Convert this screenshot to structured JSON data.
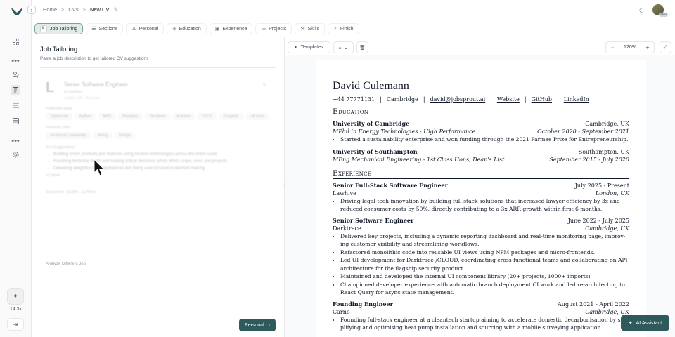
{
  "breadcrumb": {
    "home": "Home",
    "cvs": "CVs",
    "current": "New CV"
  },
  "avatar_badge": "PRO",
  "rail": {
    "count": "14.3k"
  },
  "steps": [
    {
      "label": "Job Tailoring",
      "icon": "L"
    },
    {
      "label": "Sections",
      "icon": "sliders-icon"
    },
    {
      "label": "Personal",
      "icon": "person-icon"
    },
    {
      "label": "Education",
      "icon": "graduation-cap-icon"
    },
    {
      "label": "Experience",
      "icon": "briefcase-icon"
    },
    {
      "label": "Projects",
      "icon": "folder-icon"
    },
    {
      "label": "Skills",
      "icon": "wrench-icon"
    },
    {
      "label": "Finish",
      "icon": "check-circle-icon"
    }
  ],
  "panel": {
    "title": "Job Tailoring",
    "subtitle": "Paste a job description to get tailored CV suggestions",
    "next_label": "Personal"
  },
  "job": {
    "letter": "L",
    "title": "Senior Software Engineer",
    "company": "at Lawhive",
    "meta": "London, UK · Just now",
    "preferred_label": "Preferred Skills",
    "skills": [
      "TypeScript",
      "Python",
      "AWS",
      "Postgres",
      "Terraform",
      "Kanban",
      "CI/CD",
      "GraphQL",
      "+8 more"
    ],
    "personal_label": "Personal skills",
    "personal": [
      "Technical Leadership",
      "Hiring",
      "Design"
    ],
    "suggestions_label": "Key Suggestions",
    "suggestions": [
      "Building entire products and features using modern technologies across the entire stack",
      "Reaching technical depth and making critical decisions which affect scope, ones and projects",
      "Delivering delightful user experiences and being user-focused in decision making"
    ],
    "more": "+2 more",
    "footer_meta": "Salary/min · £120k · £170k/yr",
    "analyze": "Analyze Different Job"
  },
  "toolbar": {
    "templates": "Templates",
    "zoom": "120%"
  },
  "cv": {
    "name": "David Culemann",
    "contact": {
      "phone": "+44 77771131",
      "city": "Cambridge",
      "email": "david@jobsprout.ai",
      "website": "Website",
      "github": "GitHub",
      "linkedin": "LinkedIn"
    },
    "education_heading": "Education",
    "education": [
      {
        "school": "University of Cambridge",
        "location": "Cambridge, UK",
        "degree": "MPhil in Energy Technologies - High Performance",
        "dates": "October 2020 - September 2021",
        "bullets": [
          "Started a sustainability enterprise and won funding through the 2021 Parmee Prize for Entrepreneurship."
        ]
      },
      {
        "school": "University of Southampton",
        "location": "Southampton, UK",
        "degree": "MEng Mechanical Engineering - 1st Class Hons, Dean's List",
        "dates": "September 2015 - July 2020",
        "bullets": []
      }
    ],
    "experience_heading": "Experience",
    "experience": [
      {
        "title": "Senior Full-Stack Software Engineer",
        "dates": "July 2025 - Present",
        "company": "Lawhive",
        "location": "London, UK",
        "bullets": [
          "Driving legal-tech innovation by building full-stack solutions that increased lawyer efficiency by 3x and",
          "reduced consumer costs by 50%, directly contributing to a 3x ARR growth within first 6 months."
        ]
      },
      {
        "title": "Senior Software Engineer",
        "dates": "June 2022 - July 2025",
        "company": "Darktrace",
        "location": "Cambridge, UK",
        "bullets": [
          "Delivered key projects, including a dynamic reporting dashboard and real-time monitoring page, improv-",
          "ing customer visibility and streamlining workflows.",
          "Refactored monolithic code into reusable UI views using NPM packages and micro-frontends.",
          "Led UI development for Darktrace /CLOUD, coordinating cross-functional teams and collaborating on",
          "API architecture for the flagship security product.",
          "Maintained and developed the internal UI component library (20+ projects, 1000+ imports)",
          "Championed developer experience with automatic branch deployment CI work and led re-architecting to",
          "React Query for async state management."
        ]
      },
      {
        "title": "Founding Engineer",
        "dates": "August 2021 - April 2022",
        "company": "Carno",
        "location": "Cambridge, UK",
        "bullets": [
          "Founding full-stack engineer at a cleantech startup aiming to accelerate domestic decarbonisation by sim-",
          "plifying and optimising heat pump installation and sourcing with a mobile surveying application."
        ]
      }
    ]
  },
  "ai_assistant": "AI Assistant"
}
